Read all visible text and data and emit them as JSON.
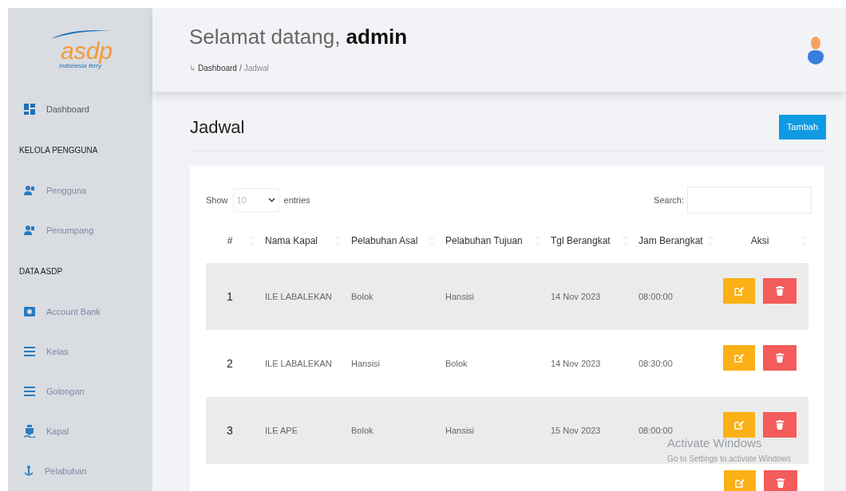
{
  "sidebar": {
    "logo": {
      "text": "asdp",
      "tagline": "Indonesia ferry"
    },
    "sections": [
      {
        "items": [
          {
            "label": "Dashboard",
            "kind": "dashboard",
            "selected": true
          }
        ]
      },
      {
        "title": "KELOLA PENGGUNA",
        "items": [
          {
            "label": "Pengguna",
            "kind": "users",
            "selected": false
          },
          {
            "label": "Penumpang",
            "kind": "users",
            "selected": false
          }
        ]
      },
      {
        "title": "DATA ASDP",
        "items": [
          {
            "label": "Account Bank",
            "kind": "bank",
            "selected": false
          },
          {
            "label": "Kelas",
            "kind": "list",
            "selected": false
          },
          {
            "label": "Golongan",
            "kind": "list",
            "selected": false
          },
          {
            "label": "Kapal",
            "kind": "ship",
            "selected": false
          },
          {
            "label": "Pelabuhan",
            "kind": "anchor",
            "selected": false
          }
        ]
      }
    ]
  },
  "header": {
    "greeting": "Selamat datang, **admin**",
    "breadcrumb_arrow": "↳",
    "breadcrumb": [
      {
        "label": "Dashboard",
        "current": false
      },
      {
        "label": "Jadwal",
        "current": true
      }
    ],
    "breadcrumb_separator": "/"
  },
  "page": {
    "title": "Jadwal",
    "add_button": "Tambah"
  },
  "table_controls": {
    "show_label": "Show",
    "page_size": "10",
    "entries_label": "entries",
    "search_label": "Search:"
  },
  "table": {
    "columns": [
      "#",
      "Nama Kapal",
      "Pelabuhan Asal",
      "Pelabuhan Tujuan",
      "Tgl Berangkat",
      "Jam Berangkat",
      "Aksi"
    ],
    "rows": [
      {
        "cells": [
          "1",
          "ILE LABALEKAN",
          "Bolok",
          "Hansisi",
          "14 Nov 2023",
          "08:00:00"
        ]
      },
      {
        "cells": [
          "2",
          "ILE LABALEKAN",
          "Hansisi",
          "Bolok",
          "14 Nov 2023",
          "08:30:00"
        ]
      },
      {
        "cells": [
          "3",
          "ILE APE",
          "Bolok",
          "Hansisi",
          "15 Nov 2023",
          "08:00:00"
        ]
      }
    ],
    "more_rows_below": true
  },
  "os_notice": {
    "title": "Activate Windows",
    "subtitle": "Go to Settings to activate Windows"
  }
}
